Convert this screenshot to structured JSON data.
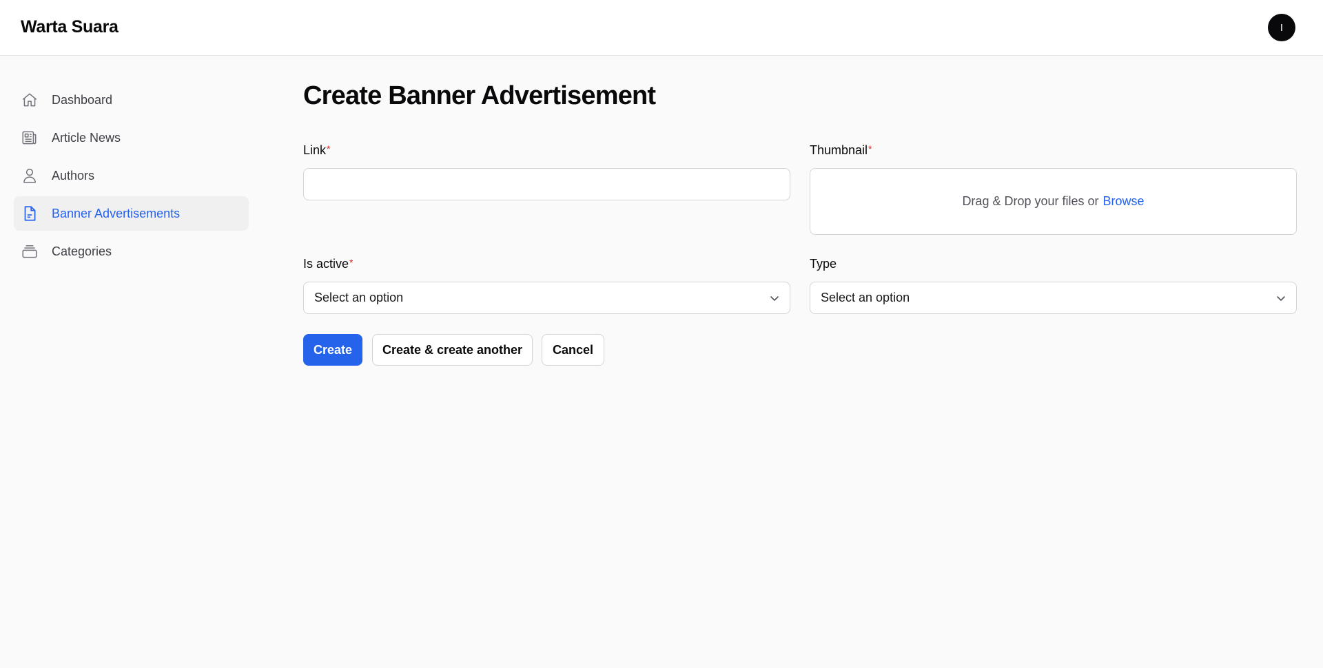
{
  "app": {
    "brand": "Warta Suara",
    "avatar_initial": "I"
  },
  "sidebar": {
    "items": [
      {
        "label": "Dashboard",
        "icon": "home-icon",
        "active": false
      },
      {
        "label": "Article News",
        "icon": "newspaper-icon",
        "active": false
      },
      {
        "label": "Authors",
        "icon": "user-icon",
        "active": false
      },
      {
        "label": "Banner Advertisements",
        "icon": "document-icon",
        "active": true
      },
      {
        "label": "Categories",
        "icon": "rectangle-stack-icon",
        "active": false
      }
    ]
  },
  "page": {
    "title": "Create Banner Advertisement"
  },
  "form": {
    "link": {
      "label": "Link",
      "required_mark": "*",
      "value": ""
    },
    "thumbnail": {
      "label": "Thumbnail",
      "required_mark": "*",
      "dropzone_text": "Drag & Drop your files or",
      "browse_label": "Browse"
    },
    "is_active": {
      "label": "Is active",
      "required_mark": "*",
      "selected": "Select an option"
    },
    "type": {
      "label": "Type",
      "selected": "Select an option"
    }
  },
  "actions": {
    "create": "Create",
    "create_another": "Create & create another",
    "cancel": "Cancel"
  },
  "colors": {
    "accent": "#2563eb",
    "required": "#dc2626",
    "background": "#fafafa",
    "active_nav_bg": "#f0f0f1"
  }
}
